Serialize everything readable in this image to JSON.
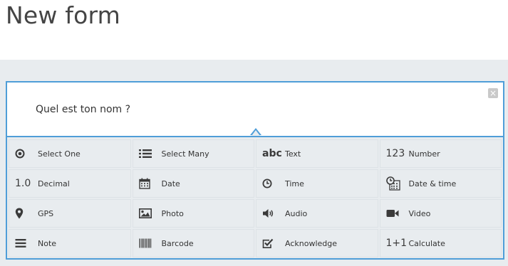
{
  "page": {
    "title": "New form"
  },
  "editor": {
    "question_label": "Quel est ton nom ?",
    "close_glyph": "×"
  },
  "question_types": [
    {
      "label": "Select One",
      "icon": "radio-icon"
    },
    {
      "label": "Select Many",
      "icon": "list-icon"
    },
    {
      "label": "Text",
      "icon": "text-abc-icon",
      "icon_text": "abc"
    },
    {
      "label": "Number",
      "icon": "number-icon",
      "icon_text": "123"
    },
    {
      "label": "Decimal",
      "icon": "decimal-icon",
      "icon_text": "1.0"
    },
    {
      "label": "Date",
      "icon": "calendar-icon"
    },
    {
      "label": "Time",
      "icon": "clock-icon"
    },
    {
      "label": "Date & time",
      "icon": "calendar-clock-icon"
    },
    {
      "label": "GPS",
      "icon": "map-pin-icon"
    },
    {
      "label": "Photo",
      "icon": "image-icon"
    },
    {
      "label": "Audio",
      "icon": "speaker-icon"
    },
    {
      "label": "Video",
      "icon": "video-camera-icon"
    },
    {
      "label": "Note",
      "icon": "note-lines-icon"
    },
    {
      "label": "Barcode",
      "icon": "barcode-icon"
    },
    {
      "label": "Acknowledge",
      "icon": "checkbox-icon"
    },
    {
      "label": "Calculate",
      "icon": "calculate-icon",
      "icon_text": "1+1"
    }
  ],
  "colors": {
    "accent": "#4f9ed8",
    "panel_bg": "#e8ecef",
    "close_bg": "#c9c9c9"
  }
}
